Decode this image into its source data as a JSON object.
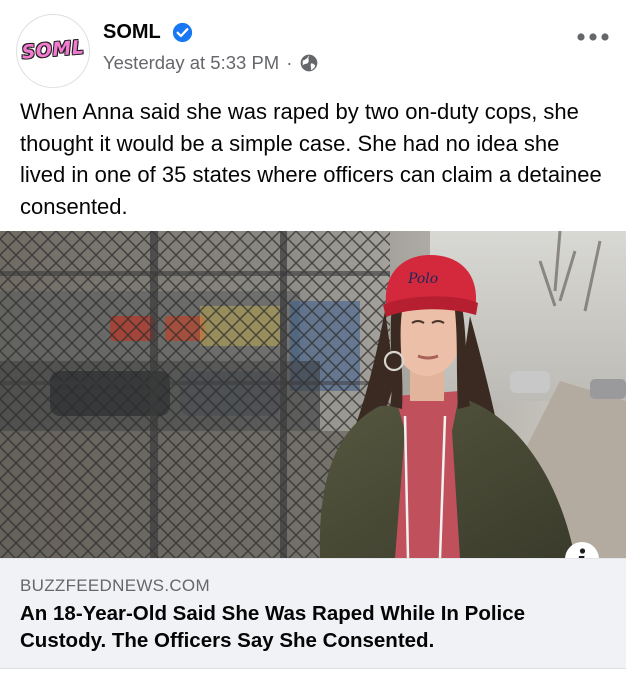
{
  "post": {
    "page_name": "SOML",
    "avatar_text": "SOML",
    "timestamp": "Yesterday at 5:33 PM",
    "separator": "·",
    "privacy_icon": "globe-icon",
    "verified_icon": "verified-badge-icon",
    "more_icon": "more-options-icon",
    "body_text": "When Anna said she was raped by two on-duty cops, she thought it would be a simple case. She had no idea she lived in one of 35 states where officers can claim a detainee consented."
  },
  "photo": {
    "cap_text": "Polo",
    "info_icon": "info-icon"
  },
  "link_card": {
    "domain": "BUZZFEEDNEWS.COM",
    "headline": "An 18-Year-Old Said She Was Raped While In Police Custody. The Officers Say She Consented."
  },
  "colors": {
    "verified_blue": "#1877f2",
    "secondary_text": "#65676b",
    "card_background": "#f0f2f5",
    "cap_red": "#d4283d",
    "logo_pink": "#f47bd0"
  }
}
